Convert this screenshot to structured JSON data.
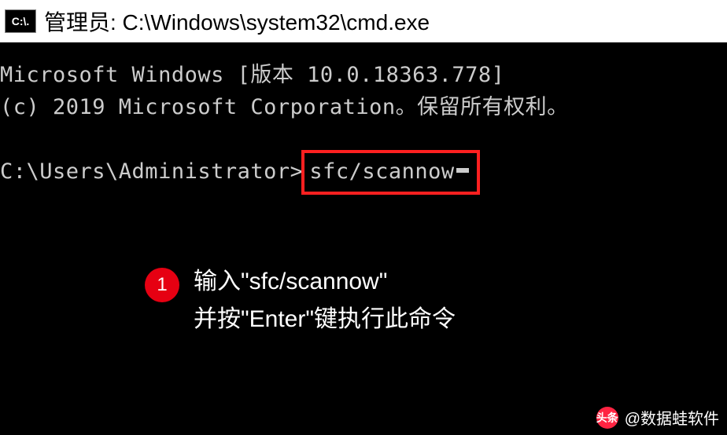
{
  "titlebar": {
    "icon_text": "C:\\.",
    "title": "管理员: C:\\Windows\\system32\\cmd.exe"
  },
  "terminal": {
    "line1": "Microsoft Windows [版本 10.0.18363.778]",
    "line2": "(c) 2019 Microsoft Corporation。保留所有权利。",
    "prompt": "C:\\Users\\Administrator>",
    "command": "sfc/scannow"
  },
  "annotation": {
    "step": "1",
    "line1": "输入\"sfc/scannow\"",
    "line2": "并按\"Enter\"键执行此命令"
  },
  "watermark": {
    "logo": "头条",
    "text": "@数据蛙软件"
  }
}
